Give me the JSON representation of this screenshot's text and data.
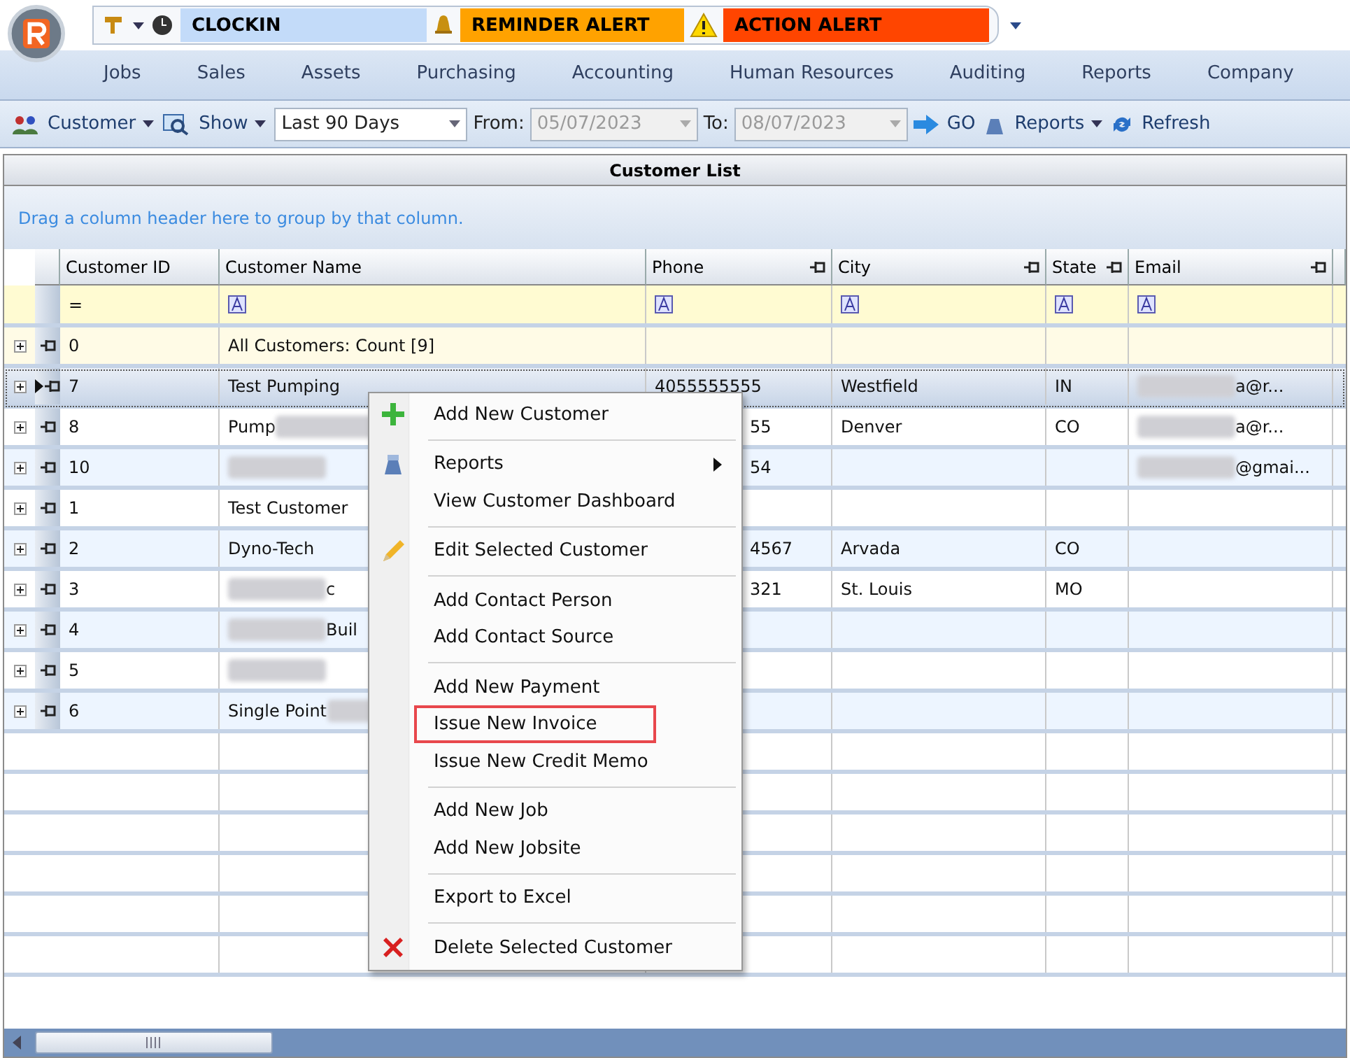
{
  "quick_bar": {
    "clock_in": "CLOCKIN",
    "reminder": "REMINDER ALERT",
    "action": "ACTION ALERT"
  },
  "ribbon_tabs": [
    {
      "label": "Jobs",
      "selected": false
    },
    {
      "label": "Sales",
      "selected": false
    },
    {
      "label": "Assets",
      "selected": false
    },
    {
      "label": "Purchasing",
      "selected": false
    },
    {
      "label": "Accounting",
      "selected": false
    },
    {
      "label": "Human Resources",
      "selected": false
    },
    {
      "label": "Auditing",
      "selected": false
    },
    {
      "label": "Reports",
      "selected": false
    },
    {
      "label": "Company",
      "selected": false
    }
  ],
  "toolbar": {
    "customer": "Customer",
    "show": "Show",
    "range": "Last 90 Days",
    "from_label": "From:",
    "from": "05/07/2023",
    "to_label": "To:",
    "to": "08/07/2023",
    "go": "GO",
    "reports": "Reports",
    "refresh": "Refresh"
  },
  "grid": {
    "title": "Customer List",
    "group_hint": "Drag a column header here to group by that column.",
    "columns": [
      "Customer ID",
      "Customer Name",
      "Phone",
      "City",
      "State",
      "Email"
    ],
    "filter_operator": "=",
    "summary": {
      "id": "0",
      "name": "All Customers: Count [9]"
    },
    "rows": [
      {
        "id": "7",
        "selected": true,
        "name": [
          {
            "kind": "text",
            "text": "Test Pumping"
          }
        ],
        "phone": "4055555555",
        "phone_covered": false,
        "city": "Westfield",
        "state": "IN",
        "email": [
          {
            "kind": "blur"
          },
          {
            "kind": "text",
            "text": "a@r..."
          }
        ]
      },
      {
        "id": "8",
        "selected": false,
        "name": [
          {
            "kind": "text",
            "text": "Pump"
          },
          {
            "kind": "blur"
          }
        ],
        "phone": "55",
        "phone_covered": true,
        "city": "Denver",
        "state": "CO",
        "email": [
          {
            "kind": "blur"
          },
          {
            "kind": "text",
            "text": "a@r..."
          }
        ]
      },
      {
        "id": "10",
        "selected": false,
        "name": [
          {
            "kind": "blur"
          }
        ],
        "phone": "54",
        "phone_covered": true,
        "city": "",
        "state": "",
        "email": [
          {
            "kind": "blur"
          },
          {
            "kind": "text",
            "text": "@gmai..."
          }
        ]
      },
      {
        "id": "1",
        "selected": false,
        "name": [
          {
            "kind": "text",
            "text": "Test Customer"
          }
        ],
        "phone": "",
        "phone_covered": false,
        "city": "",
        "state": "",
        "email": []
      },
      {
        "id": "2",
        "selected": false,
        "name": [
          {
            "kind": "text",
            "text": "Dyno-Tech"
          }
        ],
        "phone": "4567",
        "phone_covered": true,
        "city": "Arvada",
        "state": "CO",
        "email": []
      },
      {
        "id": "3",
        "selected": false,
        "name": [
          {
            "kind": "blur"
          },
          {
            "kind": "text",
            "text": "c"
          }
        ],
        "phone": "321",
        "phone_covered": true,
        "city": "St. Louis",
        "state": "MO",
        "email": []
      },
      {
        "id": "4",
        "selected": false,
        "name": [
          {
            "kind": "blur"
          },
          {
            "kind": "text",
            "text": "Buil"
          }
        ],
        "phone": "",
        "phone_covered": false,
        "city": "",
        "state": "",
        "email": []
      },
      {
        "id": "5",
        "selected": false,
        "name": [
          {
            "kind": "blur"
          }
        ],
        "phone": "",
        "phone_covered": false,
        "city": "",
        "state": "",
        "email": []
      },
      {
        "id": "6",
        "selected": false,
        "name": [
          {
            "kind": "text",
            "text": "Single Point"
          },
          {
            "kind": "blur"
          }
        ],
        "phone": "",
        "phone_covered": false,
        "city": "",
        "state": "",
        "email": []
      }
    ]
  },
  "context_menu": [
    {
      "label": "Add New Customer",
      "kind": "add",
      "submenu": false,
      "highlighted": false,
      "separator_after": true
    },
    {
      "label": "Reports",
      "kind": "report",
      "submenu": true,
      "highlighted": false,
      "separator_after": false
    },
    {
      "label": "View Customer Dashboard",
      "kind": "plain",
      "submenu": false,
      "highlighted": false,
      "separator_after": true
    },
    {
      "label": "Edit Selected Customer",
      "kind": "edit",
      "submenu": false,
      "highlighted": false,
      "separator_after": true
    },
    {
      "label": "Add Contact Person",
      "kind": "plain",
      "submenu": false,
      "highlighted": false,
      "separator_after": false
    },
    {
      "label": "Add Contact Source",
      "kind": "plain",
      "submenu": false,
      "highlighted": false,
      "separator_after": true
    },
    {
      "label": "Add New Payment",
      "kind": "plain",
      "submenu": false,
      "highlighted": false,
      "separator_after": false
    },
    {
      "label": "Issue New Invoice",
      "kind": "plain",
      "submenu": false,
      "highlighted": true,
      "separator_after": false
    },
    {
      "label": "Issue New Credit Memo",
      "kind": "plain",
      "submenu": false,
      "highlighted": false,
      "separator_after": true
    },
    {
      "label": "Add New Job",
      "kind": "plain",
      "submenu": false,
      "highlighted": false,
      "separator_after": false
    },
    {
      "label": "Add New Jobsite",
      "kind": "plain",
      "submenu": false,
      "highlighted": false,
      "separator_after": true
    },
    {
      "label": "Export to Excel",
      "kind": "plain",
      "submenu": false,
      "highlighted": false,
      "separator_after": true
    },
    {
      "label": "Delete Selected Customer",
      "kind": "delete",
      "submenu": false,
      "highlighted": false,
      "separator_after": false
    }
  ]
}
